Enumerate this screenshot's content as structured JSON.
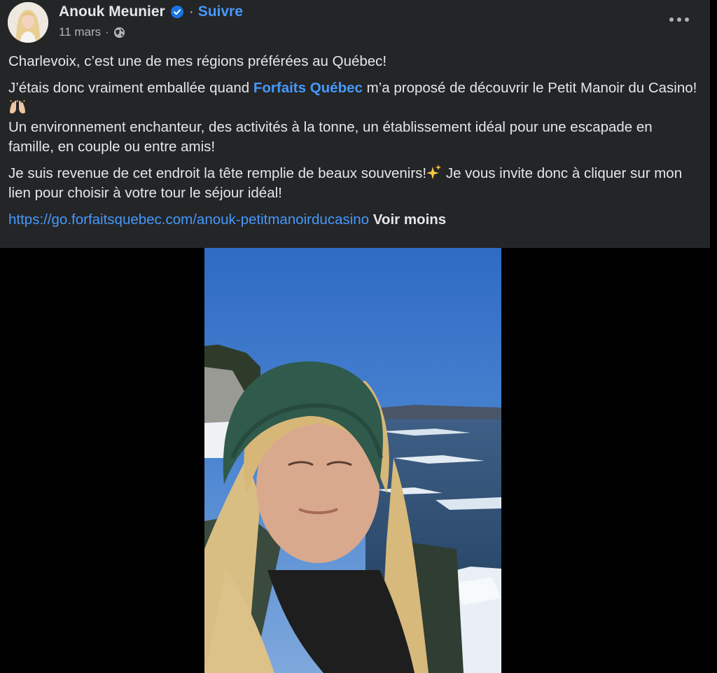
{
  "post": {
    "author": "Anouk Meunier",
    "separator": "·",
    "follow_label": "Suivre",
    "date": "11 mars",
    "meta_separator": "·",
    "privacy_icon": "globe-icon",
    "more_icon": "more-options-icon"
  },
  "content": {
    "p1": "Charlevoix, c’est une de mes régions préférées au Québec!",
    "p2_before": "J’étais donc vraiment emballée quand ",
    "p2_link": "Forfaits Québec",
    "p2_after": " m’a proposé de découvrir le Petit Manoir du Casino!",
    "p2_emoji": "raising-hands-emoji",
    "p2_line2": "Un environnement enchanteur, des activités à la tonne, un établissement idéal pour une escapade en famille, en couple ou entre amis!",
    "p3_before": "Je suis revenue de cet endroit la tête remplie de beaux souvenirs!",
    "p3_emoji": "sparkles-emoji",
    "p3_after": " Je vous invite donc à cliquer sur mon lien pour choisir à votre tour le séjour idéal!",
    "url": "https://go.forfaitsquebec.com/anouk-petitmanoirducasino",
    "see_less": "Voir moins"
  },
  "colors": {
    "card_bg": "#242526",
    "text": "#e4e6eb",
    "secondary": "#b0b3b8",
    "link": "#4599ff"
  }
}
